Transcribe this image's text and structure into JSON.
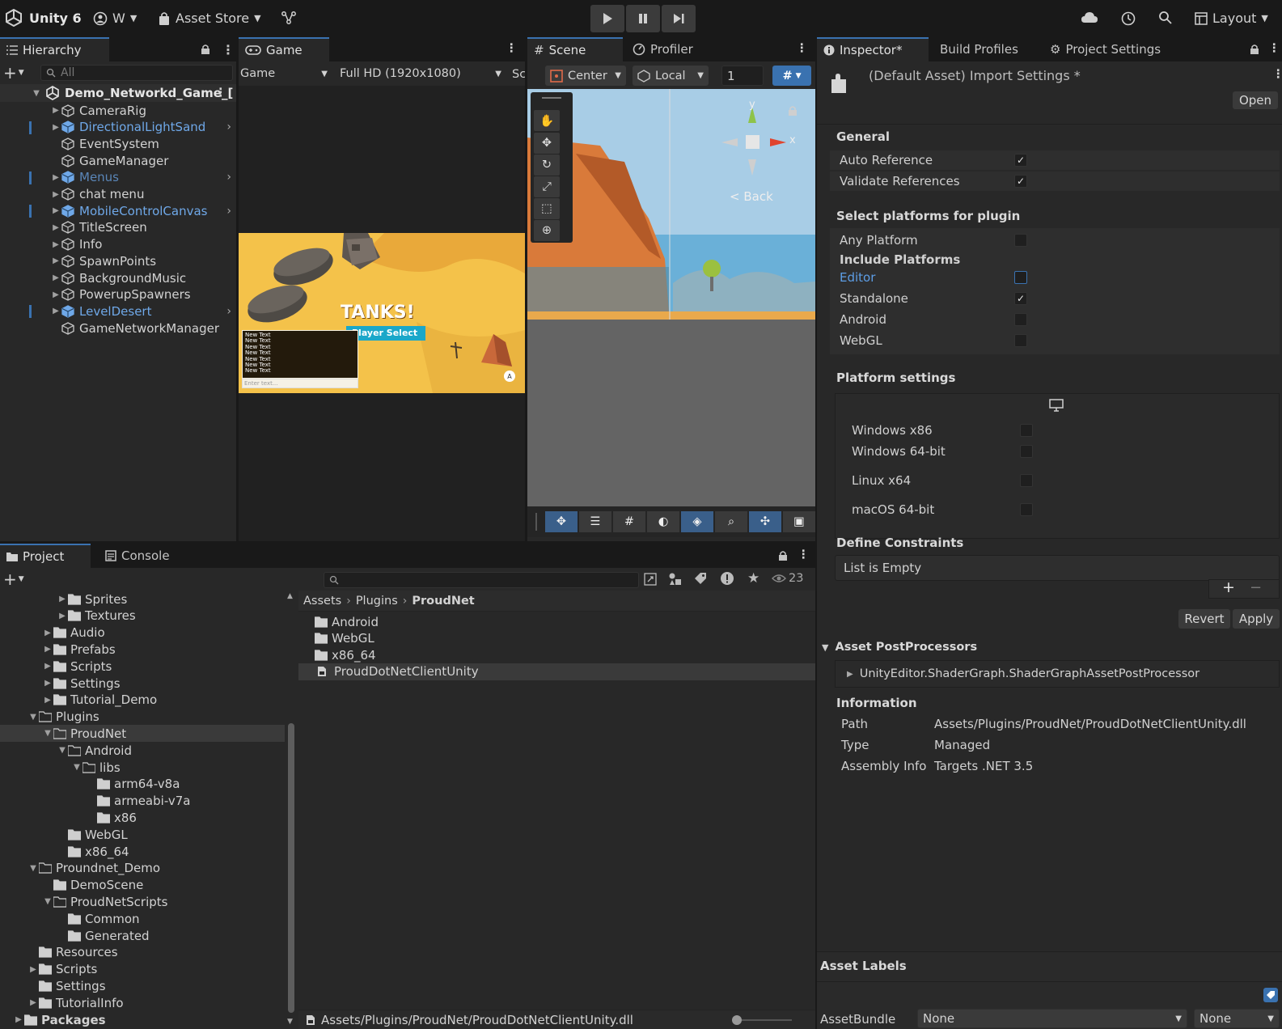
{
  "toolbar": {
    "app_title": "Unity 6",
    "account_label": "W",
    "asset_store_label": "Asset Store",
    "layout_label": "Layout"
  },
  "hierarchy": {
    "tab_label": "Hierarchy",
    "search_placeholder": "All",
    "scene_name": "Demo_Networkd_Game_[",
    "items": [
      {
        "label": "CameraRig"
      },
      {
        "label": "DirectionalLightSand"
      },
      {
        "label": "EventSystem"
      },
      {
        "label": "GameManager"
      },
      {
        "label": "Menus"
      },
      {
        "label": "chat menu"
      },
      {
        "label": "MobileControlCanvas"
      },
      {
        "label": "TitleScreen"
      },
      {
        "label": "Info"
      },
      {
        "label": "SpawnPoints"
      },
      {
        "label": "BackgroundMusic"
      },
      {
        "label": "PowerupSpawners"
      },
      {
        "label": "LevelDesert"
      },
      {
        "label": "GameNetworkManager"
      }
    ]
  },
  "game": {
    "tab_label": "Game",
    "display_select": "Game",
    "resolution_select": "Full HD (1920x1080)",
    "overflow_label": "Sc",
    "title_text": "TANKS!",
    "button_text": "Player Select",
    "chat_lines": [
      "New Text",
      "New Text",
      "New Text",
      "New Text",
      "New Text",
      "New Text",
      "New Text"
    ],
    "chat_placeholder": "Enter text...",
    "badge": "A"
  },
  "scene": {
    "tab_label": "Scene",
    "profiler_tab": "Profiler",
    "pivot_select": "Center",
    "space_select": "Local",
    "grid_value": "1",
    "gizmo_y": "y",
    "gizmo_x": "x",
    "back_label": "< Back"
  },
  "inspector": {
    "tabs": [
      "Inspector*",
      "Build Profiles",
      "Project Settings"
    ],
    "title": "(Default Asset) Import Settings *",
    "open_button": "Open",
    "general_header": "General",
    "auto_reference": "Auto Reference",
    "validate_references": "Validate References",
    "platforms_header": "Select platforms for plugin",
    "any_platform": "Any Platform",
    "include_platforms": "Include Platforms",
    "platforms": [
      {
        "label": "Editor",
        "checked": false
      },
      {
        "label": "Standalone",
        "checked": true
      },
      {
        "label": "Android",
        "checked": false
      },
      {
        "label": "WebGL",
        "checked": false
      }
    ],
    "platform_settings_header": "Platform settings",
    "os_options": [
      {
        "label": "Windows x86"
      },
      {
        "label": "Windows 64-bit"
      },
      {
        "label": "Linux x64"
      },
      {
        "label": "macOS 64-bit"
      }
    ],
    "define_constraints_header": "Define Constraints",
    "list_empty": "List is Empty",
    "plus": "+",
    "minus": "−",
    "revert_button": "Revert",
    "apply_button": "Apply",
    "postprocessors_header": "Asset PostProcessors",
    "postprocessor_item": "UnityEditor.ShaderGraph.ShaderGraphAssetPostProcessor",
    "information_header": "Information",
    "info": {
      "path_label": "Path",
      "path_value": "Assets/Plugins/ProudNet/ProudDotNetClientUnity.dll",
      "type_label": "Type",
      "type_value": "Managed",
      "assembly_label": "Assembly Info",
      "assembly_value": "Targets .NET 3.5"
    },
    "asset_labels_header": "Asset Labels",
    "assetbundle_label": "AssetBundle",
    "assetbundle_value": "None",
    "assetbundle_variant": "None"
  },
  "project": {
    "tab_label": "Project",
    "console_tab": "Console",
    "hidden_count": "23",
    "tree": [
      {
        "label": "Sprites"
      },
      {
        "label": "Textures"
      },
      {
        "label": "Audio"
      },
      {
        "label": "Prefabs"
      },
      {
        "label": "Scripts"
      },
      {
        "label": "Settings"
      },
      {
        "label": "Tutorial_Demo"
      },
      {
        "label": "Plugins"
      },
      {
        "label": "ProudNet"
      },
      {
        "label": "Android"
      },
      {
        "label": "libs"
      },
      {
        "label": "arm64-v8a"
      },
      {
        "label": "armeabi-v7a"
      },
      {
        "label": "x86"
      },
      {
        "label": "WebGL"
      },
      {
        "label": "x86_64"
      },
      {
        "label": "Proundnet_Demo"
      },
      {
        "label": "DemoScene"
      },
      {
        "label": "ProudNetScripts"
      },
      {
        "label": "Common"
      },
      {
        "label": "Generated"
      },
      {
        "label": "Resources"
      },
      {
        "label": "Scripts"
      },
      {
        "label": "Settings"
      },
      {
        "label": "TutorialInfo"
      },
      {
        "label": "Packages"
      }
    ],
    "breadcrumb": [
      "Assets",
      "Plugins",
      "ProudNet"
    ],
    "files": [
      {
        "label": "Android"
      },
      {
        "label": "WebGL"
      },
      {
        "label": "x86_64"
      },
      {
        "label": "ProudDotNetClientUnity"
      }
    ],
    "footer_path": "Assets/Plugins/ProudNet/ProudDotNetClientUnity.dll"
  },
  "colors": {
    "accent_blue": "#3a72b0",
    "prefab_blue": "#6fa8e8",
    "desert_yellow": "#f4c24a"
  }
}
